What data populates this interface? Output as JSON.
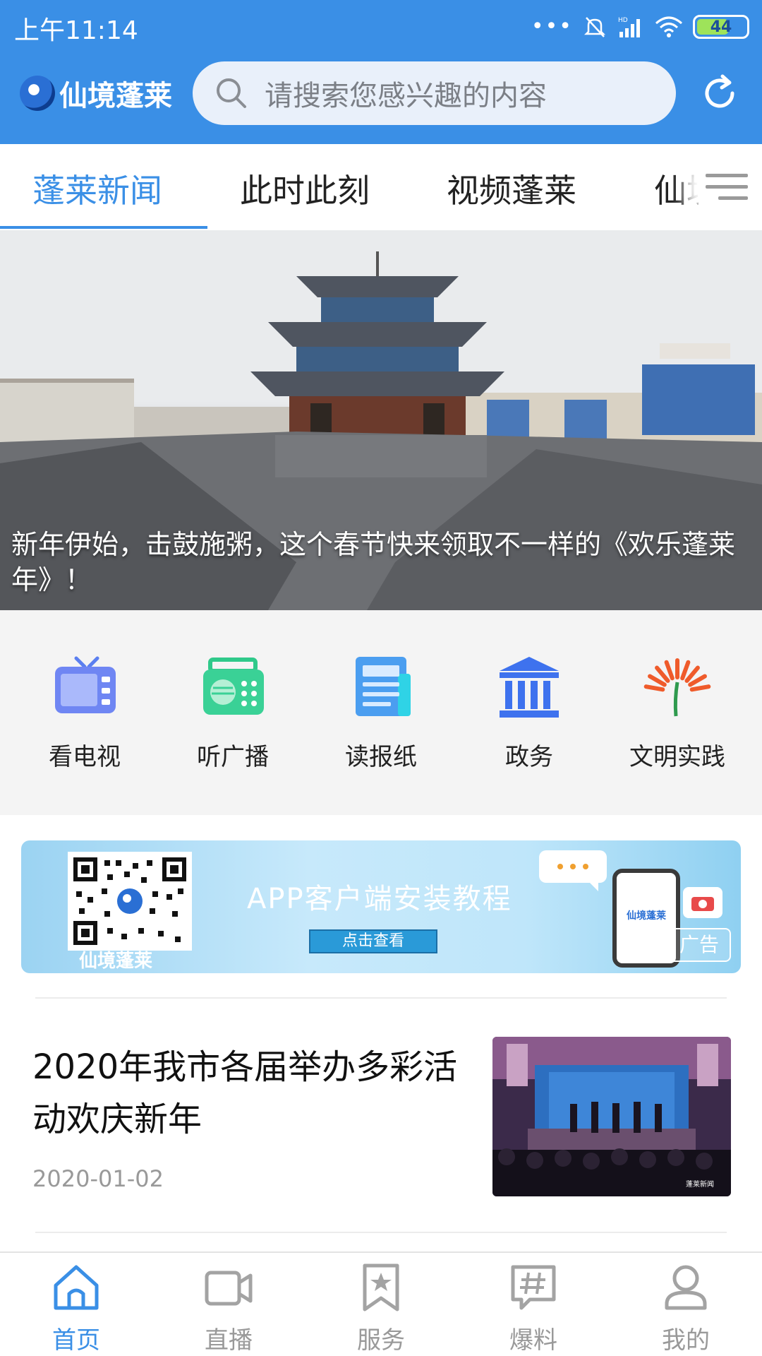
{
  "status_bar": {
    "time": "上午11:14",
    "dots": "•••",
    "battery": "44"
  },
  "header": {
    "brand_name": "仙境蓬莱",
    "search_placeholder": "请搜索您感兴趣的内容"
  },
  "tabs": [
    {
      "label": "蓬莱新闻",
      "active": true
    },
    {
      "label": "此时此刻",
      "active": false
    },
    {
      "label": "视频蓬莱",
      "active": false
    },
    {
      "label": "仙境",
      "active": false
    }
  ],
  "banner": {
    "caption": "新年伊始，击鼓施粥，这个春节快来领取不一样的《欢乐蓬莱年》！"
  },
  "quick_links": [
    {
      "label": "看电视",
      "icon": "tv-icon"
    },
    {
      "label": "听广播",
      "icon": "radio-icon"
    },
    {
      "label": "读报纸",
      "icon": "newspaper-icon"
    },
    {
      "label": "政务",
      "icon": "government-icon"
    },
    {
      "label": "文明实践",
      "icon": "civilization-icon"
    }
  ],
  "ad": {
    "title": "APP客户端安装教程",
    "button": "点击查看",
    "qr_caption": "仙境蓬莱",
    "phone_text": "仙境蓬莱",
    "tag": "广告"
  },
  "news": [
    {
      "title": "2020年我市各届举办多彩活动欢庆新年",
      "date": "2020-01-02"
    }
  ],
  "bottom_nav": [
    {
      "label": "首页",
      "icon": "home-icon",
      "active": true
    },
    {
      "label": "直播",
      "icon": "video-camera-icon",
      "active": false
    },
    {
      "label": "服务",
      "icon": "bookmark-star-icon",
      "active": false
    },
    {
      "label": "爆料",
      "icon": "hashtag-chat-icon",
      "active": false
    },
    {
      "label": "我的",
      "icon": "user-icon",
      "active": false
    }
  ],
  "colors": {
    "primary": "#3a8fe6",
    "header_bg": "#3a8fe6",
    "inactive_nav": "#999999"
  }
}
